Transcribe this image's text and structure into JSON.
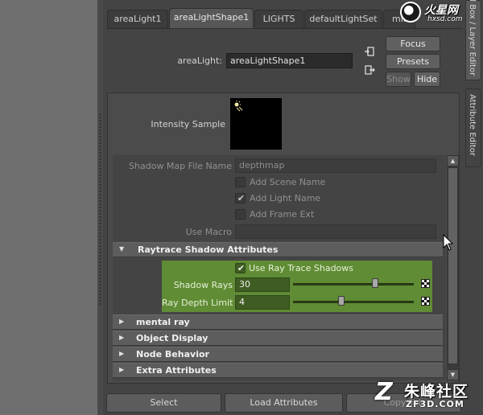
{
  "tabs": [
    {
      "label": "areaLight1",
      "active": false
    },
    {
      "label": "areaLightShape1",
      "active": true
    },
    {
      "label": "LIGHTS",
      "active": false
    },
    {
      "label": "defaultLightSet",
      "active": false
    },
    {
      "label": "mib",
      "active": false
    }
  ],
  "header": {
    "node_label": "areaLight:",
    "node_value": "areaLightShape1",
    "focus": "Focus",
    "presets": "Presets",
    "show": "Show",
    "hide": "Hide"
  },
  "sample": {
    "label": "Intensity Sample"
  },
  "shadow_map": {
    "file_name_label": "Shadow Map File Name",
    "file_name_value": "depthmap",
    "add_scene_name": {
      "label": "Add Scene Name",
      "checked": false
    },
    "add_light_name": {
      "label": "Add Light Name",
      "checked": true
    },
    "add_frame_ext": {
      "label": "Add Frame Ext",
      "checked": false
    },
    "use_macro_label": "Use Macro",
    "use_macro_value": ""
  },
  "raytrace": {
    "title": "Raytrace Shadow Attributes",
    "use_ray_trace": {
      "label": "Use Ray Trace Shadows",
      "checked": true
    },
    "shadow_rays": {
      "label": "Shadow Rays",
      "value": "30",
      "slider": 0.68
    },
    "ray_depth_limit": {
      "label": "Ray Depth Limit",
      "value": "4",
      "slider": 0.4
    },
    "highlight_color": "#5f8c34"
  },
  "sections": [
    {
      "title": "mental ray"
    },
    {
      "title": "Object Display"
    },
    {
      "title": "Node Behavior"
    },
    {
      "title": "Extra Attributes"
    }
  ],
  "bottom": {
    "select": "Select",
    "load": "Load Attributes",
    "copy": "Copy Tab"
  },
  "right_tabs": {
    "top": "Channel Box / Layer Editor",
    "bottom": "Attribute Editor"
  },
  "watermark_top": {
    "brand": "火星网",
    "url": "hxsd.com"
  },
  "watermark_bottom": {
    "cn": "朱峰社区",
    "en": "ZF3D.COM"
  },
  "icons": {
    "input_conn": "input-connection-icon",
    "output_conn": "output-connection-icon",
    "expanded": "triangle-down-icon",
    "collapsed": "triangle-right-icon",
    "map": "checker-map-icon"
  }
}
